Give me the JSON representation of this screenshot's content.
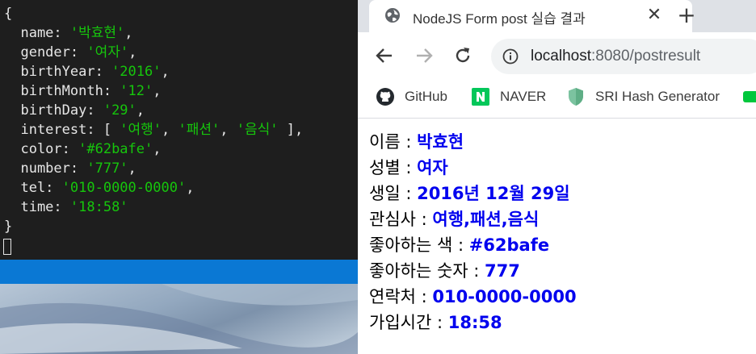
{
  "terminal": {
    "lines": [
      {
        "t": "{"
      },
      {
        "k": "  name: ",
        "v": "'박효현'",
        "e": ","
      },
      {
        "k": "  gender: ",
        "v": "'여자'",
        "e": ","
      },
      {
        "k": "  birthYear: ",
        "v": "'2016'",
        "e": ","
      },
      {
        "k": "  birthMonth: ",
        "v": "'12'",
        "e": ","
      },
      {
        "k": "  birthDay: ",
        "v": "'29'",
        "e": ","
      },
      {
        "k": "  interest: [ ",
        "v": "'여행'",
        "e": ", ",
        "v2": "'패션'",
        "e2": ", ",
        "v3": "'음식'",
        "e3": " ],"
      },
      {
        "k": "  color: ",
        "v": "'#62bafe'",
        "e": ","
      },
      {
        "k": "  number: ",
        "v": "'777'",
        "e": ","
      },
      {
        "k": "  tel: ",
        "v": "'010-0000-0000'",
        "e": ","
      },
      {
        "k": "  time: ",
        "v": "'18:58'",
        "e": ""
      },
      {
        "t": "}"
      }
    ],
    "string_color": "#16c60c"
  },
  "browser": {
    "tab": {
      "title": "NodeJS Form post 실습 결과",
      "close_label": "✕",
      "favicon": "globe-icon"
    },
    "new_tab_label": "+",
    "toolbar": {
      "url_host": "localhost",
      "url_rest": ":8080/postresult"
    },
    "bookmarks": [
      {
        "label": "GitHub",
        "icon": "github-icon"
      },
      {
        "label": "NAVER",
        "icon": "naver-icon"
      },
      {
        "label": "SRI Hash Generator",
        "icon": "shield-icon"
      }
    ],
    "content": [
      {
        "label": "이름 : ",
        "value": "박효현"
      },
      {
        "label": "성별 : ",
        "value": "여자"
      },
      {
        "label": "생일 : ",
        "value": "2016년 12월 29일"
      },
      {
        "label": "관심사 : ",
        "value": "여행,패션,음식"
      },
      {
        "label": "좋아하는 색 : ",
        "value": "#62bafe"
      },
      {
        "label": "좋아하는 숫자 : ",
        "value": "777"
      },
      {
        "label": "연락처 : ",
        "value": "010-0000-0000"
      },
      {
        "label": "가입시간 : ",
        "value": "18:58"
      }
    ]
  },
  "colors": {
    "terminal_bg": "#1e1e1e",
    "statusbar": "#0a78d4",
    "value_text": "#0000ee",
    "naver_green": "#03c75a"
  }
}
